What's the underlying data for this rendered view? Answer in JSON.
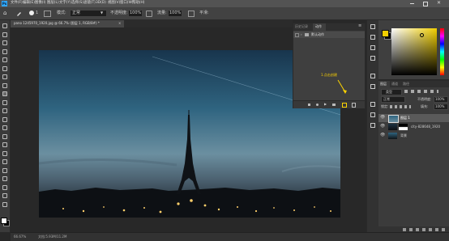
{
  "menu": [
    "文件(F)",
    "编辑(E)",
    "图像(I)",
    "图层(L)",
    "文字(Y)",
    "选择(S)",
    "滤镜(T)",
    "3D(D)",
    "视图(V)",
    "窗口(W)",
    "帮助(H)"
  ],
  "options": {
    "brush_size": "1",
    "mode_label": "模式:",
    "mode_value": "正常",
    "opacity_label": "不透明度:",
    "opacity_value": "100%",
    "flow_label": "流量:",
    "flow_value": "100%",
    "smooth_label": "平滑:"
  },
  "doc_tab": {
    "label": "pano 1245970_1920.jpg @ 66.7% (图层 1, RGB/8#) *"
  },
  "history_panel": {
    "tabs": [
      "历史记录",
      "动作"
    ],
    "row_label": "默认动作",
    "annotation": "1.点击创建"
  },
  "layers_panel": {
    "tabs": [
      "图层",
      "通道",
      "路径"
    ],
    "kind_label": "类型",
    "blend_mode": "正常",
    "opacity_label": "不透明度:",
    "opacity_value": "100%",
    "lock_label": "锁定:",
    "fill_label": "填充:",
    "fill_value": "100%",
    "layers": [
      {
        "name": "图层 1"
      },
      {
        "name": "city-828648_1920"
      },
      {
        "name": "背景"
      }
    ]
  },
  "status": {
    "zoom": "66.67%",
    "doc_size": "文档:5.93M/11.2M"
  },
  "colors": {
    "foreground": "#ffffff",
    "background": "#000000",
    "swatch_fg": "#f2cf00",
    "accent": "#ffd400"
  }
}
